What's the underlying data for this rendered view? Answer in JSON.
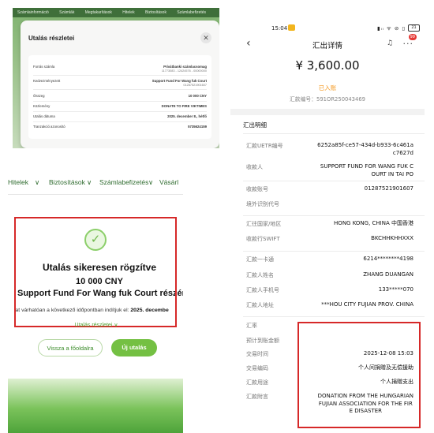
{
  "otp_modal": {
    "topbar_items": [
      "Számlainformáció",
      "Számlák",
      "Megtakarítások",
      "Hitelek",
      "Biztosítások",
      "Számlabefizetés"
    ],
    "title": "Utalás részletei",
    "close_icon": "close-icon",
    "rows": [
      {
        "label": "Forrás számla",
        "value": "Privátbanki számlacsomag",
        "sub": "11773083 - 12424576 - 00000000"
      },
      {
        "label": "Kedvezményezett",
        "value": "Support Fund For Wang fuk Court",
        "sub": "01287521901607"
      },
      {
        "label": "Összeg",
        "value": "10 000 CNY",
        "sub": ""
      },
      {
        "label": "Közlemény",
        "value": "DONATE TO FIRE VIKTIMES",
        "sub": ""
      },
      {
        "label": "Utalás dátuma",
        "value": "2025. december 8., hétfő",
        "sub": ""
      },
      {
        "label": "Tranzakció azonosító",
        "value": "5735624159",
        "sub": ""
      }
    ]
  },
  "otp_success": {
    "menu": [
      "Hitelek",
      "Biztosítások",
      "Számlabefizetés",
      "Vásárl"
    ],
    "menu_icon": "chevron-down-icon",
    "success_icon": "check-circle-icon",
    "title": "Utalás sikeresen rögzítve",
    "amount": "10 000 CNY",
    "recipient": "Support Fund For Wang fuk Court részére",
    "note_prefix": "lat várhatóan a következő időpontban indítjuk el: ",
    "note_date": "2025. decembe",
    "details_link": "Utalás részletei ∨",
    "back_button": "Vissza a főoldalra",
    "new_transfer_button": "Új utalás"
  },
  "remittance": {
    "status": {
      "time": "15:04",
      "icons": "▮ᵢₗ ᯤ ⊘ ▯",
      "battery": "21"
    },
    "nav_title": "汇出详情",
    "badge": "99",
    "amount": "¥ 3,600.00",
    "status_text": "已入账",
    "remit_no": "汇款编号：591OR250043469",
    "section": "汇出明细",
    "rows": [
      {
        "k": "汇款UETR编号",
        "v": [
          "6252a85f-ce57-434d-b933-6c461a",
          "c7627d"
        ]
      },
      {
        "k": "收款人",
        "v": [
          "SUPPORT FUND FOR WANG FUK C",
          "OURT IN TAI PO"
        ]
      },
      {
        "k": "收款账号",
        "v": [
          "01287521901607"
        ]
      },
      {
        "k": "境外识别代号",
        "v": [
          ""
        ]
      },
      {
        "k": "汇往国家/地区",
        "v": [
          "HONG KONG, CHINA 中国香港"
        ]
      },
      {
        "k": "收款行SWIFT",
        "v": [
          "BKCHHKHHXXX"
        ]
      },
      {
        "k": "汇款一卡通",
        "v": [
          "6214********4198"
        ]
      },
      {
        "k": "汇款人姓名",
        "v": [
          "ZHANG DUANGAN"
        ]
      },
      {
        "k": "汇款人手机号",
        "v": [
          "133*****070"
        ]
      },
      {
        "k": "汇款人地址",
        "v": [
          "***HOU CITY FUJIAN PROV. CHINA"
        ]
      },
      {
        "k": "汇率",
        "v": [
          ""
        ]
      },
      {
        "k": "预计到账金额",
        "v": [
          ""
        ]
      },
      {
        "k": "交易时间",
        "v": [
          "2025-12-08 15:03"
        ]
      },
      {
        "k": "交易编码",
        "v": [
          "个人间捐赠及无偿援助"
        ]
      },
      {
        "k": "汇款用途",
        "v": [
          "个人捐赠支出"
        ]
      },
      {
        "k": "汇款附言",
        "v": [
          "DONATION FROM THE HUNGARIAN",
          "FUJIAN ASSOCIATION FOR THE FIR",
          "E DISASTER"
        ]
      }
    ]
  },
  "colors": {
    "green": "#74c043",
    "red_box": "#d62828",
    "orange": "#f59a23"
  }
}
